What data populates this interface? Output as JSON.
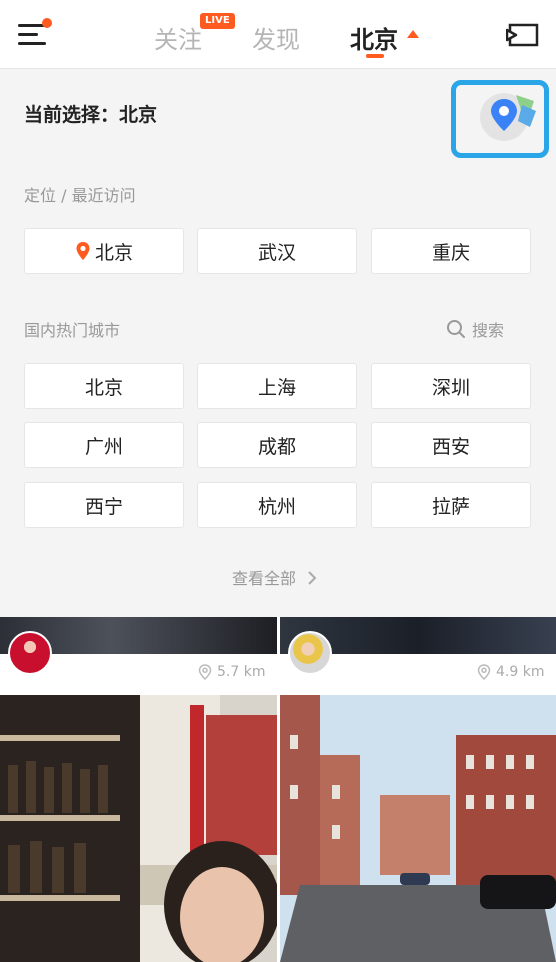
{
  "header": {
    "tabs": [
      {
        "label": "关注",
        "badge": "LIVE"
      },
      {
        "label": "发现"
      },
      {
        "label": "北京"
      }
    ]
  },
  "current": {
    "text": "当前选择：北京"
  },
  "sections": {
    "recent_label": "定位 / 最近访问",
    "hot_label": "国内热门城市",
    "search_label": "搜索",
    "view_all": "查看全部"
  },
  "recent_cities": [
    "北京",
    "武汉",
    "重庆"
  ],
  "hot_cities": [
    "北京",
    "上海",
    "深圳",
    "广州",
    "成都",
    "西安",
    "西宁",
    "杭州",
    "拉萨"
  ],
  "feed": {
    "cards": [
      {
        "distance": "5.7 km"
      },
      {
        "distance": "4.9 km"
      }
    ]
  },
  "colors": {
    "accent": "#ff5a1f",
    "highlight_box": "#2aa6e8"
  }
}
